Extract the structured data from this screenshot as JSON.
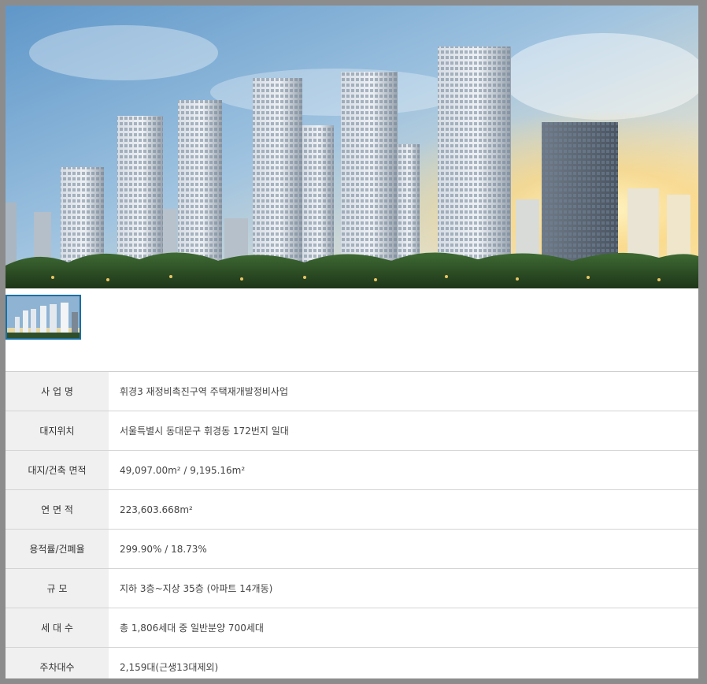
{
  "hero_image": {
    "description_icon": "apartment-rendering-image"
  },
  "thumbnail": {
    "icon": "apartment-thumbnail-image"
  },
  "rows": [
    {
      "label": "사 업 명",
      "value": "휘경3 재정비촉진구역 주택재개발정비사업"
    },
    {
      "label": "대지위치",
      "value": "서울특별시 동대문구 휘경동 172번지 일대"
    },
    {
      "label": "대지/건축 면적",
      "value": "49,097.00m² / 9,195.16m²"
    },
    {
      "label": "연 면 적",
      "value": "223,603.668m²"
    },
    {
      "label": "용적률/건폐율",
      "value": "299.90% / 18.73%"
    },
    {
      "label": "규 모",
      "value": "지하 3층~지상 35층 (아파트 14개동)"
    },
    {
      "label": "세 대 수",
      "value": "총 1,806세대 중 일반분양 700세대"
    },
    {
      "label": "주차대수",
      "value": "2,159대(근생13대제외)"
    }
  ]
}
